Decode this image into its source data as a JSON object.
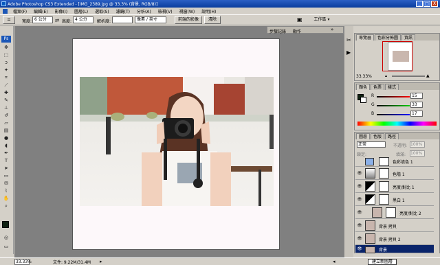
{
  "titlebar": {
    "title": "Adobe Photoshop CS3 Extended - [IMG_2389.jpg @ 33.3% (背景, RGB/8)]",
    "min": "_",
    "max": "□",
    "close": "X"
  },
  "menu": [
    "檔案(F)",
    "編輯(E)",
    "影像(I)",
    "圖層(L)",
    "選取(S)",
    "濾鏡(T)",
    "分析(A)",
    "檢視(V)",
    "視窗(W)",
    "說明(H)"
  ],
  "options": {
    "width_label": "寬度:",
    "width_value": "6 公分",
    "height_label": "高度:",
    "height_value": "4 公分",
    "resolution_label": "解析度:",
    "resolution_value": "",
    "unit_value": "像素 / 英寸",
    "front_image": "前端的影像",
    "clear": "清除",
    "workspace": "工作區 ▾"
  },
  "docktabs": {
    "history": "步驟記錄",
    "actions": "動作"
  },
  "navigator": {
    "tabs": [
      "導覽器",
      "色彩分佈圖",
      "資訊"
    ],
    "zoom": "33.33%"
  },
  "color": {
    "tabs": [
      "顏色",
      "色票",
      "樣式"
    ],
    "r_label": "R",
    "g_label": "G",
    "b_label": "B",
    "r": 15,
    "g": 33,
    "b": 17
  },
  "layers": {
    "tabs": [
      "圖層",
      "色版",
      "路徑"
    ],
    "blend": "正常",
    "opacity_label": "不透明:",
    "opacity": "100%",
    "lock_label": "鎖定:",
    "fill_label": "填滿:",
    "fill": "100%",
    "items": [
      {
        "name": "色彩填色 1"
      },
      {
        "name": "色階 1"
      },
      {
        "name": "亮度/對比 1"
      },
      {
        "name": "黑白 1"
      },
      {
        "name": "亮度/對比 2"
      },
      {
        "name": "背景 拷貝"
      },
      {
        "name": "背景 拷貝 2"
      },
      {
        "name": "背景"
      }
    ],
    "footer_label": "建立新圖層"
  },
  "status": {
    "zoom": "33.33%",
    "doc": "文件: 9.22M/31.4M"
  },
  "colors": {
    "title": "#0a3d9e",
    "selected_layer": "#0a246a",
    "nav_box": "#cc0000"
  }
}
